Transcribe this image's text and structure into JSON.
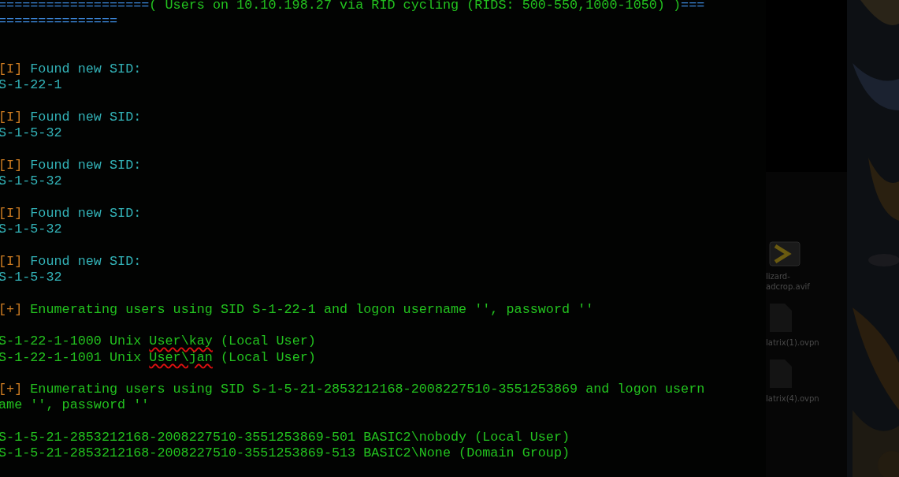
{
  "terminal": {
    "lines": [
      {
        "kind": "text",
        "segments": [
          {
            "kind": "rule",
            "text": "==================="
          },
          {
            "kind": "output",
            "text": "( Users on 10.10.198.27 via RID cycling (RIDS: 500-550,1000-1050) )"
          },
          {
            "kind": "rule",
            "text": "==="
          }
        ]
      },
      {
        "kind": "text",
        "segments": [
          {
            "kind": "rule",
            "text": "==============="
          }
        ]
      },
      {
        "kind": "blank"
      },
      {
        "kind": "blank"
      },
      {
        "kind": "text",
        "segments": [
          {
            "kind": "tag",
            "text": "[I]"
          },
          {
            "kind": "info",
            "text": " Found new SID:"
          }
        ]
      },
      {
        "kind": "text",
        "segments": [
          {
            "kind": "info",
            "text": "S-1-22-1"
          }
        ]
      },
      {
        "kind": "blank"
      },
      {
        "kind": "text",
        "segments": [
          {
            "kind": "tag",
            "text": "[I]"
          },
          {
            "kind": "info",
            "text": " Found new SID:"
          }
        ]
      },
      {
        "kind": "text",
        "segments": [
          {
            "kind": "info",
            "text": "S-1-5-32"
          }
        ]
      },
      {
        "kind": "blank"
      },
      {
        "kind": "text",
        "segments": [
          {
            "kind": "tag",
            "text": "[I]"
          },
          {
            "kind": "info",
            "text": " Found new SID:"
          }
        ]
      },
      {
        "kind": "text",
        "segments": [
          {
            "kind": "info",
            "text": "S-1-5-32"
          }
        ]
      },
      {
        "kind": "blank"
      },
      {
        "kind": "text",
        "segments": [
          {
            "kind": "tag",
            "text": "[I]"
          },
          {
            "kind": "info",
            "text": " Found new SID:"
          }
        ]
      },
      {
        "kind": "text",
        "segments": [
          {
            "kind": "info",
            "text": "S-1-5-32"
          }
        ]
      },
      {
        "kind": "blank"
      },
      {
        "kind": "text",
        "segments": [
          {
            "kind": "tag",
            "text": "[I]"
          },
          {
            "kind": "info",
            "text": " Found new SID:"
          }
        ]
      },
      {
        "kind": "text",
        "segments": [
          {
            "kind": "info",
            "text": "S-1-5-32"
          }
        ]
      },
      {
        "kind": "blank"
      },
      {
        "kind": "text",
        "segments": [
          {
            "kind": "tag",
            "text": "[+]"
          },
          {
            "kind": "output",
            "text": " Enumerating users using SID S-1-22-1 and logon username '', password ''"
          }
        ]
      },
      {
        "kind": "blank"
      },
      {
        "kind": "text",
        "segments": [
          {
            "kind": "output",
            "text": "S-1-22-1-1000 Unix "
          },
          {
            "kind": "marked",
            "text": "User\\kay"
          },
          {
            "kind": "output",
            "text": " (Local User)"
          }
        ]
      },
      {
        "kind": "text",
        "segments": [
          {
            "kind": "output",
            "text": "S-1-22-1-1001 Unix "
          },
          {
            "kind": "marked",
            "text": "User\\jan"
          },
          {
            "kind": "output",
            "text": " (Local User)"
          }
        ]
      },
      {
        "kind": "blank"
      },
      {
        "kind": "text",
        "segments": [
          {
            "kind": "tag",
            "text": "[+]"
          },
          {
            "kind": "output",
            "text": " Enumerating users using SID S-1-5-21-2853212168-2008227510-3551253869 and logon usern"
          }
        ]
      },
      {
        "kind": "text",
        "segments": [
          {
            "kind": "output",
            "text": "ame '', password ''"
          }
        ]
      },
      {
        "kind": "blank"
      },
      {
        "kind": "text",
        "segments": [
          {
            "kind": "output",
            "text": "S-1-5-21-2853212168-2008227510-3551253869-501 BASIC2\\nobody (Local User)"
          }
        ]
      },
      {
        "kind": "text",
        "segments": [
          {
            "kind": "output",
            "text": "S-1-5-21-2853212168-2008227510-3551253869-513 BASIC2\\None (Domain Group)"
          }
        ]
      }
    ]
  },
  "file_panel": {
    "files": [
      {
        "kind": "app",
        "name": "lizard-\nadcrop.avif"
      },
      {
        "kind": "doc",
        "name": "latrix(1).ovpn"
      },
      {
        "kind": "doc",
        "name": "latrix(4).ovpn"
      }
    ]
  }
}
